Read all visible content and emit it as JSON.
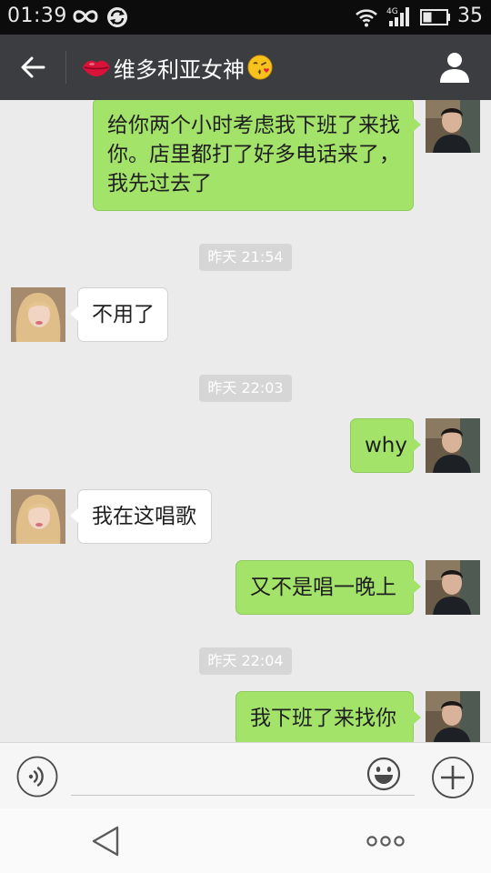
{
  "status_bar": {
    "time": "01:39",
    "battery_percent": "35",
    "icons": [
      "infinity-icon",
      "sync-icon",
      "wifi-icon",
      "4g-signal-icon",
      "battery-icon"
    ],
    "signal_label": "4G"
  },
  "header": {
    "title": "维多利亚女神",
    "icons": [
      "back-arrow-icon",
      "lips-icon",
      "kiss-emoji-icon",
      "profile-icon"
    ]
  },
  "messages": [
    {
      "sender": "me",
      "text": "给你两个小时考虑我下班了来找你。店里都打了好多电话来了，我先过去了"
    },
    {
      "timestamp": "昨天 21:54"
    },
    {
      "sender": "her",
      "text": "不用了"
    },
    {
      "timestamp": "昨天 22:03"
    },
    {
      "sender": "me",
      "text": "why"
    },
    {
      "sender": "her",
      "text": "我在这唱歌"
    },
    {
      "sender": "me",
      "text": "又不是唱一晚上"
    },
    {
      "timestamp": "昨天 22:04"
    },
    {
      "sender": "me",
      "text": "我下班了来找你"
    }
  ],
  "input_bar": {
    "message_value": "",
    "icons": [
      "voice-icon",
      "emoji-icon",
      "plus-icon"
    ]
  },
  "nav_bar": {
    "icons": [
      "nav-back-icon",
      "overflow-menu-icon"
    ]
  },
  "colors": {
    "status_bar": "#0c0c0c",
    "title_bar": "#3b3d41",
    "chat_background": "#ebebeb",
    "outgoing_bubble": "#a4e36a",
    "incoming_bubble": "#ffffff",
    "timestamp_chip": "#d6d6d6"
  }
}
